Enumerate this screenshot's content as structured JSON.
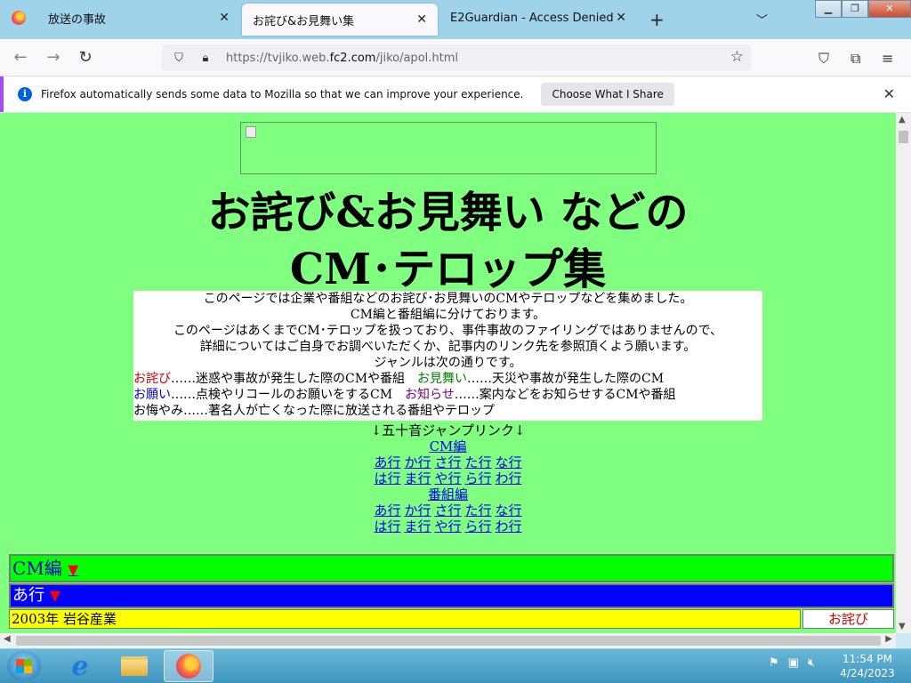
{
  "browser": {
    "tabs": [
      {
        "title": "放送の事故",
        "active": false
      },
      {
        "title": "お詫び&お見舞い集",
        "active": true
      },
      {
        "title": "E2Guardian - Access Denied",
        "active": false
      }
    ],
    "new_tab_icon": "+",
    "url_prefix": "https://tvjiko.web.",
    "url_domain": "fc2.com",
    "url_path": "/jiko/apol.html",
    "notification": {
      "message": "Firefox automatically sends some data to Mozilla so that we can improve your experience.",
      "button": "Choose What I Share"
    }
  },
  "page": {
    "title_line1": "お詫び&お見舞い などの",
    "title_line2": "CM･テロップ集",
    "intro_lines": [
      "このページでは企業や番組などのお詫び･お見舞いのCMやテロップなどを集めました。",
      "CM編と番組編に分けております。",
      "このページはあくまでCM･テロップを扱っており、事件事故のファイリングではありませんので、",
      "詳細についてはご自身でお調べいただくか、記事内のリンク先を参照頂くよう願います。",
      "ジャンルは次の通りです。"
    ],
    "genres": {
      "owabi_label": "お詫び",
      "owabi_desc": "……迷惑や事故が発生した際のCMや番組　",
      "omimai_label": "お見舞い",
      "omimai_desc": "……天災や事故が発生した際のCM",
      "onegai_label": "お願い",
      "onegai_desc": "……点検やリコールのお願いをするCM　",
      "oshirase_label": "お知らせ",
      "oshirase_desc": "……案内などをお知らせするCMや番組",
      "okuyami_label": "お悔やみ",
      "okuyami_desc": "……著名人が亡くなった際に放送される番組やテロップ"
    },
    "jump_heading": "↓五十音ジャンプリンク↓",
    "cm_link": "CM編",
    "program_link": "番組編",
    "rows_a": [
      "あ行",
      "か行",
      "さ行",
      "た行",
      "な行"
    ],
    "rows_b": [
      "は行",
      "ま行",
      "や行",
      "ら行",
      "わ行"
    ],
    "cm_section_label": "CM編",
    "a_section_label": "あ行",
    "triangle": "▼",
    "first_entry": "2003年 岩谷産業",
    "first_entry_tag": "お詫び"
  },
  "taskbar": {
    "time": "11:54 PM",
    "date": "4/24/2023"
  }
}
